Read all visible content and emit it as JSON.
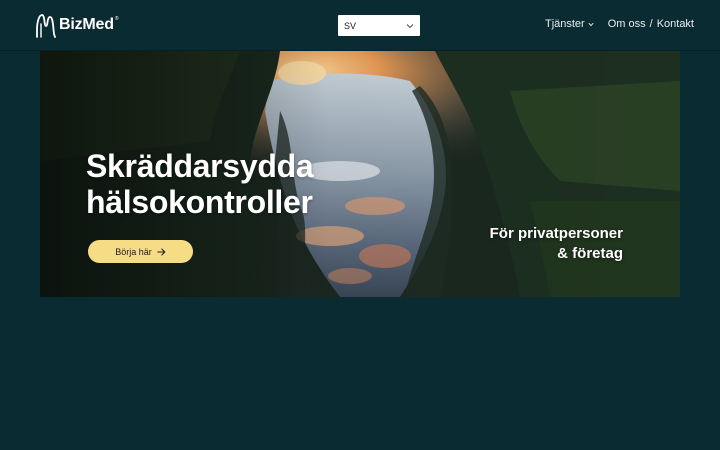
{
  "brand": {
    "name": "BizMed",
    "mark": "®",
    "logo_icon": "bizmed-logo-icon"
  },
  "language": {
    "selected": "SV",
    "icon": "chevron-down-icon"
  },
  "nav": {
    "services": "Tjänster",
    "about": "Om oss",
    "separator": "/",
    "contact": "Kontakt"
  },
  "hero": {
    "title_line1": "Skräddarsydda",
    "title_line2": "hälsokontroller",
    "subtitle_line1": "För privatpersoner",
    "subtitle_line2": "& företag",
    "cta_label": "Börja här",
    "cta_icon": "arrow-right-icon",
    "image": "forest-river-sunset-reflection"
  },
  "colors": {
    "background": "#0b2b32",
    "cta": "#f7dc86",
    "text": "#ffffff"
  }
}
